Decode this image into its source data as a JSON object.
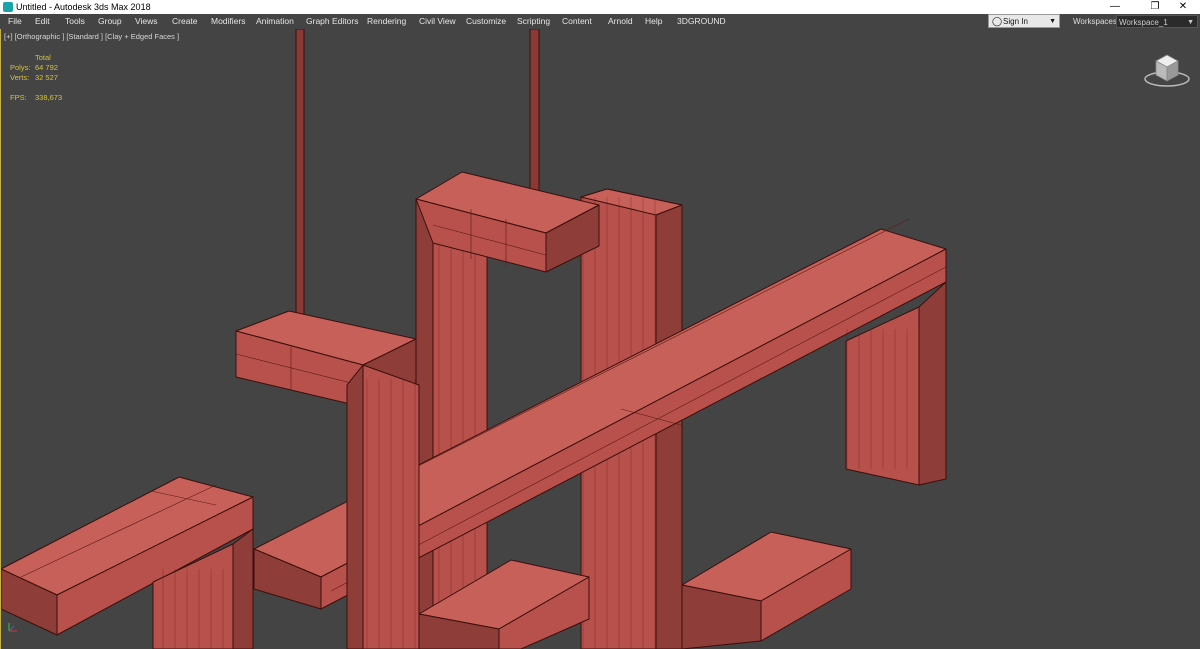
{
  "window": {
    "title": "Untitled - Autodesk 3ds Max 2018",
    "controls": {
      "minimize": "—",
      "restore": "❐",
      "close": "✕"
    }
  },
  "menu": [
    "File",
    "Edit",
    "Tools",
    "Group",
    "Views",
    "Create",
    "Modifiers",
    "Animation",
    "Graph Editors",
    "Rendering",
    "Civil View",
    "Customize",
    "Scripting",
    "Content",
    "Arnold",
    "Help",
    "3DGROUND"
  ],
  "account": {
    "signin_label": "Sign In",
    "person_icon": "person-icon"
  },
  "workspaces": {
    "label": "Workspaces:",
    "value": "Workspace_1"
  },
  "viewport": {
    "label": "[+] [Orthographic ] [Standard ] [Clay + Edged Faces ]",
    "stats": {
      "header": "Total",
      "polys_label": "Polys:",
      "polys_value": "64 792",
      "verts_label": "Verts:",
      "verts_value": "32 527",
      "fps_label": "FPS:",
      "fps_value": "338,673"
    },
    "colors": {
      "clay": "#b8514b",
      "clay_dark": "#8a3a36",
      "edge": "#4a1410",
      "background": "#444444",
      "stats_text": "#d6c23a"
    }
  }
}
